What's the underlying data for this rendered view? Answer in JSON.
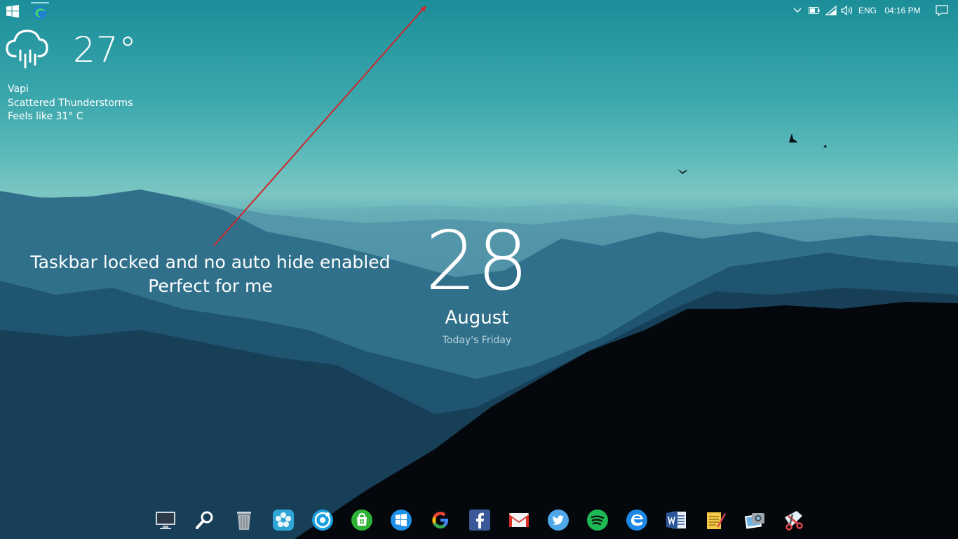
{
  "taskbar": {
    "start_icon": "windows-logo-icon",
    "pinned_icon": "edge-browser-icon",
    "tray": {
      "language": "ENG",
      "time": "04:16 PM",
      "icons": [
        "chevron-up-icon",
        "battery-icon",
        "wifi-icon",
        "volume-icon",
        "notification-icon"
      ]
    }
  },
  "weather": {
    "icon": "rain-cloud-icon",
    "temperature": "27°",
    "city": "Vapi",
    "condition": "Scattered Thunderstorms",
    "feels_like": "Feels like 31° C"
  },
  "annotation": {
    "line1": "Taskbar locked and no auto hide enabled",
    "line2": "Perfect for me",
    "arrow_color": "#d0262b"
  },
  "date_widget": {
    "day": "28",
    "month": "August",
    "weekday": "Today's Friday"
  },
  "dock": {
    "items": [
      {
        "icon": "monitor-icon"
      },
      {
        "icon": "search-icon"
      },
      {
        "icon": "recycle-bin-icon"
      },
      {
        "icon": "settings-flower-icon"
      },
      {
        "icon": "music-player-icon"
      },
      {
        "icon": "store-icon"
      },
      {
        "icon": "windows-icon"
      },
      {
        "icon": "google-icon"
      },
      {
        "icon": "facebook-icon"
      },
      {
        "icon": "gmail-icon"
      },
      {
        "icon": "twitter-icon"
      },
      {
        "icon": "spotify-icon"
      },
      {
        "icon": "edge-icon"
      },
      {
        "icon": "word-icon"
      },
      {
        "icon": "notes-icon"
      },
      {
        "icon": "photos-icon"
      },
      {
        "icon": "snipping-tool-icon"
      }
    ]
  }
}
